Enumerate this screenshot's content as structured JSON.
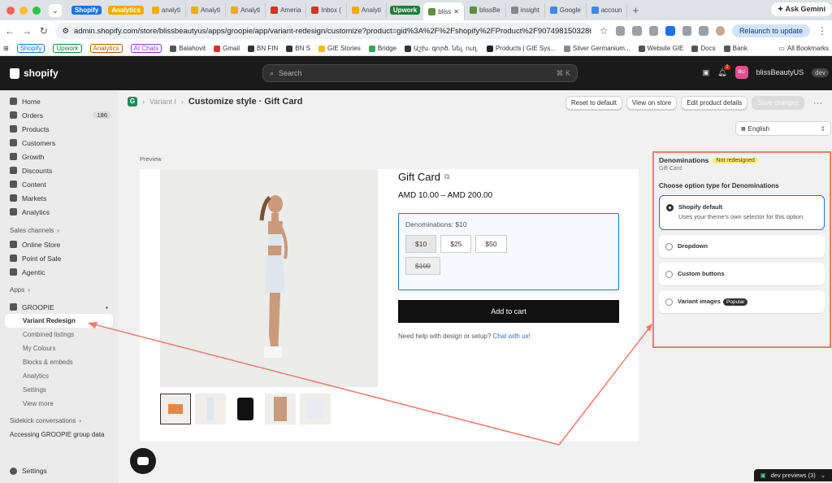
{
  "browser": {
    "tabs": [
      {
        "label": "Shopify",
        "type": "group",
        "color": "#1a73e8"
      },
      {
        "label": "Analytics",
        "type": "group",
        "color": "#f9ab00"
      },
      {
        "label": "analyti",
        "type": "tab",
        "color": "#f9ab00"
      },
      {
        "label": "Analyti",
        "type": "tab",
        "color": "#f9ab00"
      },
      {
        "label": "Analyti",
        "type": "tab",
        "color": "#f9ab00"
      },
      {
        "label": "Ameria",
        "type": "tab",
        "color": "#d93025"
      },
      {
        "label": "Inbox (",
        "type": "tab",
        "color": "#d93025"
      },
      {
        "label": "Analyti",
        "type": "tab",
        "color": "#f9ab00"
      },
      {
        "label": "Upwork",
        "type": "group",
        "color": "#188038"
      },
      {
        "label": "bliss",
        "type": "active",
        "color": "#5e8e3e"
      },
      {
        "label": "blissBe",
        "type": "tab",
        "color": "#5e8e3e"
      },
      {
        "label": "insight",
        "type": "tab",
        "color": "#888888"
      },
      {
        "label": "Google",
        "type": "tab",
        "color": "#4285f4"
      },
      {
        "label": "accoun",
        "type": "tab",
        "color": "#4285f4"
      }
    ],
    "ask_gemini": "Ask Gemini",
    "url": "admin.shopify.com/store/blissbeautyus/apps/groopie/app/variant-redesign/customize?product=gid%3A%2F%2Fshopify%2FProduct%2F9074981503286&title...",
    "relaunch": "Relaunch to update",
    "bookmarks": [
      {
        "label": "Shopify",
        "pill": true,
        "color": "#1a73e8"
      },
      {
        "label": "Upwork",
        "pill": true,
        "color": "#188038"
      },
      {
        "label": "Analytics",
        "pill": true,
        "color": "#b06000"
      },
      {
        "label": "AI Chats",
        "pill": true,
        "color": "#9334e6"
      },
      {
        "label": "Balahovit",
        "pill": false,
        "color": "#555555"
      },
      {
        "label": "Gmail",
        "pill": false,
        "color": "#d93025"
      },
      {
        "label": "BN FIN",
        "pill": false,
        "color": "#333333"
      },
      {
        "label": "BN S",
        "pill": false,
        "color": "#333333"
      },
      {
        "label": "GIE Stories",
        "pill": false,
        "color": "#fbbc04"
      },
      {
        "label": "Bridge",
        "pill": false,
        "color": "#34a853"
      },
      {
        "label": "Աշխ. գործ. նել. ուղ.",
        "pill": false,
        "color": "#333333"
      },
      {
        "label": "Products | GIE Sys...",
        "pill": false,
        "color": "#222222"
      },
      {
        "label": "Silver Germanium...",
        "pill": false,
        "color": "#888888"
      },
      {
        "label": "Website GIE",
        "pill": false,
        "color": "#555555"
      },
      {
        "label": "Docs",
        "pill": false,
        "color": "#555555"
      },
      {
        "label": "Bank",
        "pill": false,
        "color": "#555555"
      }
    ],
    "all_bookmarks": "All Bookmarks"
  },
  "topbar": {
    "brand": "shopify",
    "search_placeholder": "Search",
    "search_shortcut": "⌘ K",
    "notif_count": "2",
    "avatar_initials": "BU",
    "store_name": "blissBeautyUS",
    "env_badge": "dev"
  },
  "sidebar": {
    "main": [
      {
        "label": "Home",
        "count": ""
      },
      {
        "label": "Orders",
        "count": "186"
      },
      {
        "label": "Products",
        "count": ""
      },
      {
        "label": "Customers",
        "count": ""
      },
      {
        "label": "Growth",
        "count": ""
      },
      {
        "label": "Discounts",
        "count": ""
      },
      {
        "label": "Content",
        "count": ""
      },
      {
        "label": "Markets",
        "count": ""
      },
      {
        "label": "Analytics",
        "count": ""
      }
    ],
    "sales_channels_label": "Sales channels",
    "sales_channels": [
      "Online Store",
      "Point of Sale",
      "Agentic"
    ],
    "apps_label": "Apps",
    "app_name": "GROOPIE",
    "app_items": [
      "Variant Redesign",
      "Combined listings",
      "My Colours",
      "Blocks & embeds",
      "Analytics",
      "Settings",
      "View more"
    ],
    "sidekick_label": "Sidekick conversations",
    "sidekick_item": "Accessing GROOPIE group data",
    "settings": "Settings"
  },
  "header": {
    "crumb": "Variant I",
    "title": "Customize style · Gift Card",
    "buttons": {
      "reset": "Reset to default",
      "view_store": "View on store",
      "edit_details": "Edit product details",
      "save": "Save changes"
    },
    "language": "English"
  },
  "preview": {
    "label": "Preview",
    "product_title": "Gift Card",
    "price": "AMD 10.00 – AMD 200.00",
    "option_label": "Denominations: $10",
    "swatches": [
      {
        "label": "$10",
        "state": "selected"
      },
      {
        "label": "$25",
        "state": "normal"
      },
      {
        "label": "$50",
        "state": "normal"
      },
      {
        "label": "$100",
        "state": "soldout"
      }
    ],
    "add_to_cart": "Add to cart",
    "help_text": "Need help with design or setup?",
    "help_link": "Chat with us!"
  },
  "panel": {
    "title": "Denominations",
    "status_badge": "Not redesigned",
    "subtitle": "Gift Card",
    "question": "Choose option type for Denominations",
    "options": [
      {
        "label": "Shopify default",
        "desc": "Uses your theme's own selector for this option.",
        "selected": true,
        "badge": ""
      },
      {
        "label": "Dropdown",
        "desc": "",
        "selected": false,
        "badge": ""
      },
      {
        "label": "Custom buttons",
        "desc": "",
        "selected": false,
        "badge": ""
      },
      {
        "label": "Variant images",
        "desc": "",
        "selected": false,
        "badge": "Popular"
      }
    ]
  },
  "dev_previews": "dev previews (3)",
  "colors": {
    "annotation": "#f07b6d",
    "accent": "#2c6ecb",
    "dark": "#1a1a1a"
  }
}
